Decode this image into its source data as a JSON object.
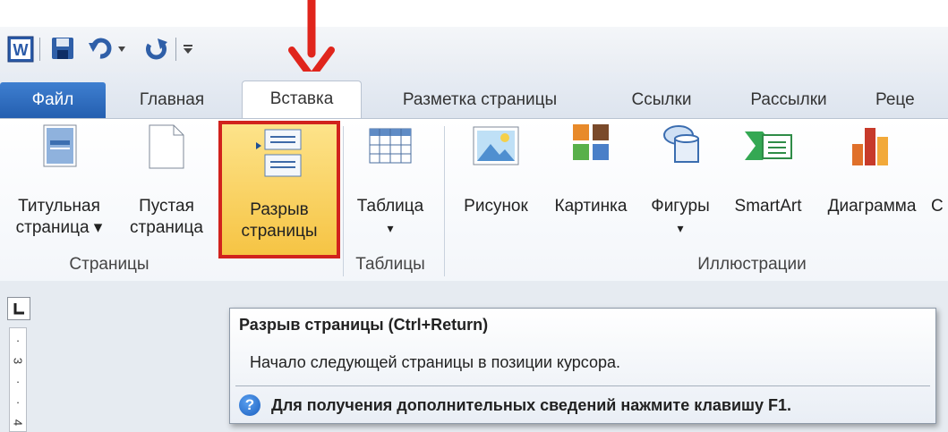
{
  "qat": {
    "icons": [
      "word-icon",
      "save-icon",
      "undo-icon",
      "undo-dropdown-icon",
      "redo-icon",
      "customize-qat-icon"
    ]
  },
  "tabs": [
    {
      "label": "Файл"
    },
    {
      "label": "Главная"
    },
    {
      "label": "Вставка"
    },
    {
      "label": "Разметка страницы"
    },
    {
      "label": "Ссылки"
    },
    {
      "label": "Рассылки"
    },
    {
      "label": "Реце"
    }
  ],
  "ribbon": {
    "pages_group": {
      "title_page": {
        "line1": "Титульная",
        "line2": "страница ▾"
      },
      "blank_page": {
        "line1": "Пустая",
        "line2": "страница"
      },
      "page_break": {
        "line1": "Разрыв",
        "line2": "страницы"
      },
      "label": "Страницы"
    },
    "tables_group": {
      "table": {
        "line1": "Таблица",
        "line2": "▾"
      },
      "label": "Таблицы"
    },
    "illustrations_group": {
      "picture": "Рисунок",
      "clipart": "Картинка",
      "shapes": {
        "line1": "Фигуры",
        "line2": "▾"
      },
      "smartart": "SmartArt",
      "chart": "Диаграмма",
      "cut": "С",
      "label": "Иллюстрации"
    }
  },
  "ruler": {
    "marks": [
      "·",
      "3",
      "·",
      "·",
      "4"
    ]
  },
  "tooltip": {
    "title": "Разрыв страницы (Ctrl+Return)",
    "description": "Начало следующей страницы в позиции курсора.",
    "help_glyph": "?",
    "help": "Для получения дополнительных сведений нажмите клавишу F1."
  },
  "colors": {
    "highlight_border": "#d1221d",
    "arrow": "#e0251c",
    "file_tab": "#2d6bc2"
  }
}
